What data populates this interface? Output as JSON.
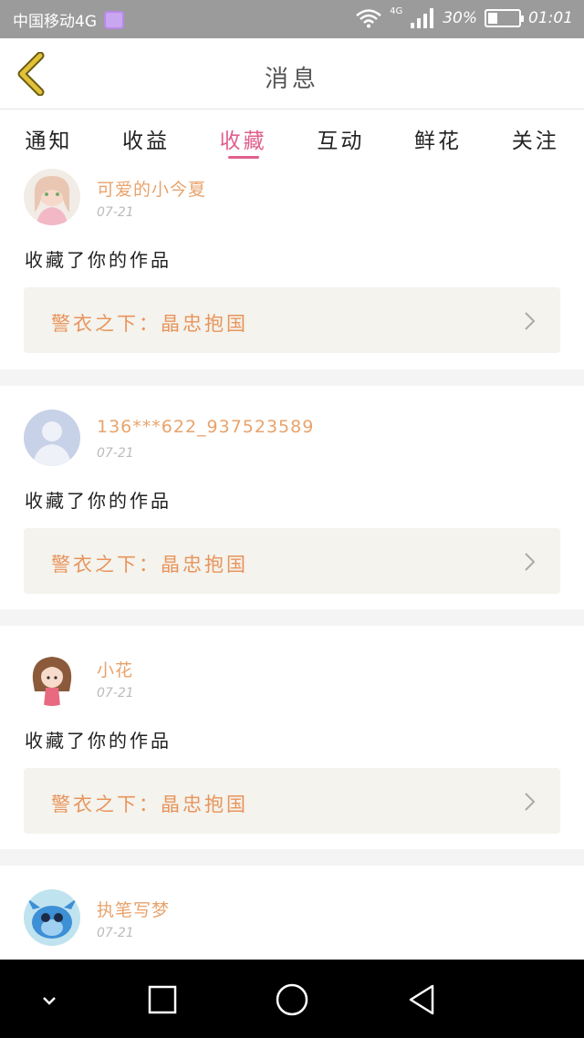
{
  "status_bar": {
    "carrier": "中国移动4G",
    "network": "4G",
    "battery": "30%",
    "battery_level": 0.3,
    "time": "01:01"
  },
  "header": {
    "title": "消息"
  },
  "tabs": [
    {
      "label": "通知",
      "active": false
    },
    {
      "label": "收益",
      "active": false
    },
    {
      "label": "收藏",
      "active": true
    },
    {
      "label": "互动",
      "active": false
    },
    {
      "label": "鲜花",
      "active": false
    },
    {
      "label": "关注",
      "active": false
    }
  ],
  "items": [
    {
      "username": "可爱的小今夏",
      "date": "07-21",
      "message": "收藏了你的作品",
      "work_title": "警衣之下：晶忠抱国"
    },
    {
      "username": "136***622_937523589",
      "date": "07-21",
      "message": "收藏了你的作品",
      "work_title": "警衣之下：晶忠抱国"
    },
    {
      "username": "小花",
      "date": "07-21",
      "message": "收藏了你的作品",
      "work_title": "警衣之下：晶忠抱国"
    },
    {
      "username": "执笔写梦",
      "date": "07-21"
    }
  ],
  "colors": {
    "accent": "#e05f8e",
    "username": "#e8a36c",
    "work_title": "#e8945c",
    "back_arrow": "#e0c23a"
  }
}
